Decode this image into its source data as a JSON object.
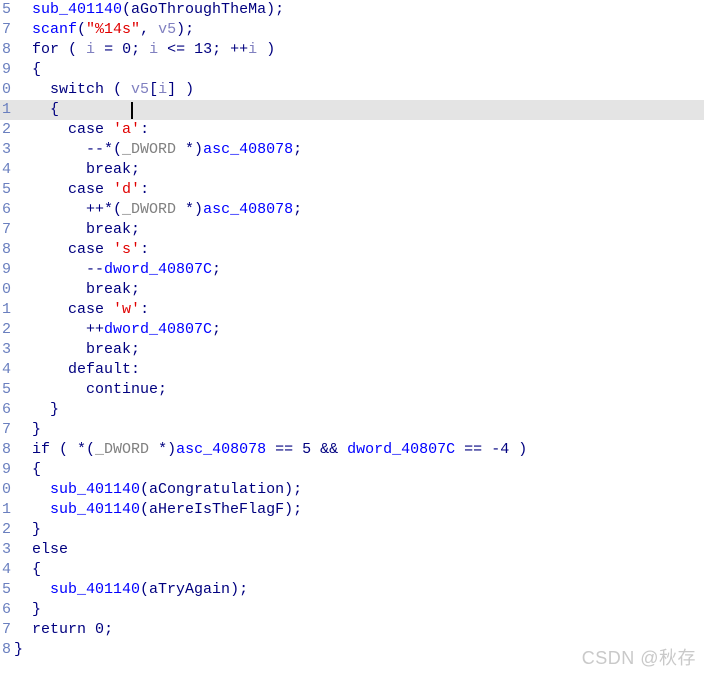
{
  "view": {
    "name": "hex-rays-pseudocode",
    "background_color": "#ffffff",
    "highlight_color": "#e4e4e4",
    "highlighted_line_index": 6
  },
  "colors": {
    "keyword": "#00007f",
    "function": "#0000ff",
    "global": "#0000ff",
    "local_variable": "#8080c0",
    "number": "#00007f",
    "string_literal": "#e00000",
    "type": "#808080",
    "line_number": "#6a7fbf",
    "caret": "#000000",
    "watermark": "#c9c9c9"
  },
  "lines": [
    {
      "number": "5",
      "indent": 2,
      "text": "sub_401140(aGoThroughTheMa);"
    },
    {
      "number": "7",
      "indent": 2,
      "text": "scanf(\"%14s\", v5);"
    },
    {
      "number": "8",
      "indent": 2,
      "text": "for ( i = 0; i <= 13; ++i )"
    },
    {
      "number": "9",
      "indent": 2,
      "text": "{"
    },
    {
      "number": "0",
      "indent": 4,
      "text": "switch ( v5[i] )"
    },
    {
      "number": "1",
      "indent": 4,
      "text": "{"
    },
    {
      "number": "2",
      "indent": 6,
      "text": "case 'a':"
    },
    {
      "number": "3",
      "indent": 8,
      "text": "--*(_DWORD *)asc_408078;"
    },
    {
      "number": "4",
      "indent": 8,
      "text": "break;"
    },
    {
      "number": "5",
      "indent": 6,
      "text": "case 'd':"
    },
    {
      "number": "6",
      "indent": 8,
      "text": "++*(_DWORD *)asc_408078;"
    },
    {
      "number": "7",
      "indent": 8,
      "text": "break;"
    },
    {
      "number": "8",
      "indent": 6,
      "text": "case 's':"
    },
    {
      "number": "9",
      "indent": 8,
      "text": "--dword_40807C;"
    },
    {
      "number": "0",
      "indent": 8,
      "text": "break;"
    },
    {
      "number": "1",
      "indent": 6,
      "text": "case 'w':"
    },
    {
      "number": "2",
      "indent": 8,
      "text": "++dword_40807C;"
    },
    {
      "number": "3",
      "indent": 8,
      "text": "break;"
    },
    {
      "number": "4",
      "indent": 6,
      "text": "default:"
    },
    {
      "number": "5",
      "indent": 8,
      "text": "continue;"
    },
    {
      "number": "6",
      "indent": 4,
      "text": "}"
    },
    {
      "number": "7",
      "indent": 2,
      "text": "}"
    },
    {
      "number": "8",
      "indent": 2,
      "text": "if ( *(_DWORD *)asc_408078 == 5 && dword_40807C == -4 )"
    },
    {
      "number": "9",
      "indent": 2,
      "text": "{"
    },
    {
      "number": "0",
      "indent": 4,
      "text": "sub_401140(aCongratulation);"
    },
    {
      "number": "1",
      "indent": 4,
      "text": "sub_401140(aHereIsTheFlagF);"
    },
    {
      "number": "2",
      "indent": 2,
      "text": "}"
    },
    {
      "number": "3",
      "indent": 2,
      "text": "else"
    },
    {
      "number": "4",
      "indent": 2,
      "text": "{"
    },
    {
      "number": "5",
      "indent": 4,
      "text": "sub_401140(aTryAgain);"
    },
    {
      "number": "6",
      "indent": 2,
      "text": "}"
    },
    {
      "number": "7",
      "indent": 2,
      "text": "return 0;"
    },
    {
      "number": "8",
      "indent": 0,
      "text": "}"
    }
  ],
  "tokens": {
    "function_names": [
      "sub_401140",
      "scanf"
    ],
    "keywords": [
      "for",
      "switch",
      "case",
      "default",
      "break",
      "continue",
      "if",
      "else",
      "return"
    ],
    "globals": [
      "asc_408078",
      "dword_40807C"
    ],
    "locals": [
      "v5",
      "i"
    ],
    "types": [
      "_DWORD"
    ],
    "string_args": [
      "aGoThroughTheMa",
      "aCongratulation",
      "aHereIsTheFlagF",
      "aTryAgain"
    ],
    "string_literals": [
      "\"%14s\"",
      "'a'",
      "'d'",
      "'s'",
      "'w'"
    ],
    "numbers": [
      "0",
      "13",
      "5",
      "-4"
    ]
  },
  "watermark": {
    "text": "CSDN @秋存"
  }
}
